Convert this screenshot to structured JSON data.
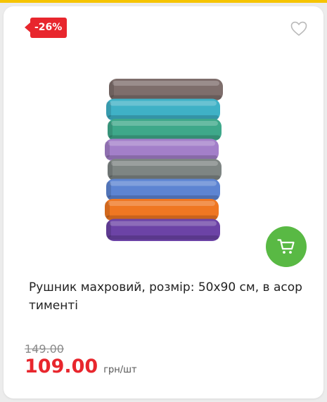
{
  "product": {
    "discount_badge": "-26%",
    "title": "Рушник махровий, розмір: 50х90 см, в асор тименті",
    "old_price": "149.00",
    "price": "109.00",
    "unit": "грн/шт",
    "image_icon": "towel-stack-image",
    "wishlist_icon": "heart-outline-icon",
    "cart_icon": "cart-icon",
    "towel_colors": [
      "#7e6e6c",
      "#3fb1c6",
      "#3ea88a",
      "#a37fc9",
      "#7e8583",
      "#5d84d2",
      "#ef7722",
      "#6c43a6"
    ]
  },
  "colors": {
    "accent_red": "#e8262d",
    "accent_green": "#59b944",
    "top_bar": "#f6c400"
  }
}
